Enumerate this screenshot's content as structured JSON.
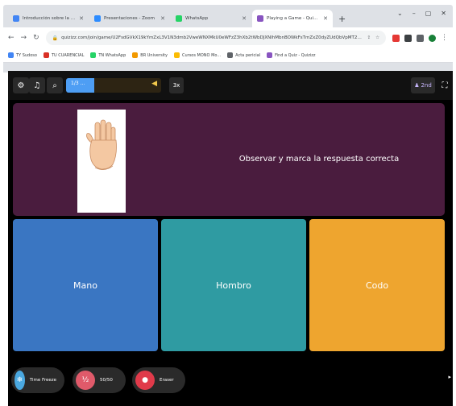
{
  "browser": {
    "tabs": [
      {
        "title": "Introducción sobre la lección",
        "icon": "doc-icon",
        "color": "#4285f4",
        "active": false
      },
      {
        "title": "Presentaciones - Zoom",
        "icon": "zoom-icon",
        "color": "#2d8cff",
        "active": false
      },
      {
        "title": "WhatsApp",
        "icon": "whatsapp-icon",
        "color": "#25d366",
        "active": false
      },
      {
        "title": "Playing a Game - Quizizz",
        "icon": "quizizz-icon",
        "color": "#8854c0",
        "active": true
      }
    ],
    "tab_close_glyph": "✕",
    "new_tab_glyph": "+",
    "window_controls": [
      "⌄",
      "–",
      "▢",
      "✕"
    ],
    "url": "quizizz.com/join/game/U2FsdGVkX19kYmZxL3V1N3dmb2VweWNXMkU0eWFzZ3hXb2tWbDJXNlhMbnBOWkFsTmZxZ0dyZUdQbVpMT2t4bk9sSWpRNnA4",
    "bookmarks": [
      {
        "label": "TY Sudoso",
        "color": "#4285f4"
      },
      {
        "label": "TU CUARENCIAL",
        "color": "#d93025"
      },
      {
        "label": "TN WhatsApp",
        "color": "#25d366"
      },
      {
        "label": "BR University",
        "color": "#f29900"
      },
      {
        "label": "Cursos MONO Mo...",
        "color": "#fbbc04"
      },
      {
        "label": "Acta pericial",
        "color": "#5f6368"
      },
      {
        "label": "Find a Quiz - Quizizz",
        "color": "#8854c0"
      }
    ]
  },
  "quiz": {
    "progress": {
      "label": "1/3 ...",
      "fraction": 0.3,
      "tail_glyph": "◀"
    },
    "counter": "3x",
    "right_button": {
      "icon": "person-icon",
      "label": "2nd"
    },
    "question": {
      "text": "Observar y marca la respuesta correcta",
      "image": "hand-image"
    },
    "options": [
      {
        "label": "Mano",
        "color": "#3a76c2"
      },
      {
        "label": "Hombro",
        "color": "#2f9ba2"
      },
      {
        "label": "Codo",
        "color": "#eea52f"
      }
    ],
    "powerups": [
      {
        "label": "Time Freeze",
        "icon": "snowflake-icon",
        "color": "#4aa8e0"
      },
      {
        "label": "50/50",
        "icon": "fifty-icon",
        "color": "#e05a6a"
      },
      {
        "label": "Eraser",
        "icon": "eraser-icon",
        "color": "#e03a4a"
      }
    ]
  }
}
